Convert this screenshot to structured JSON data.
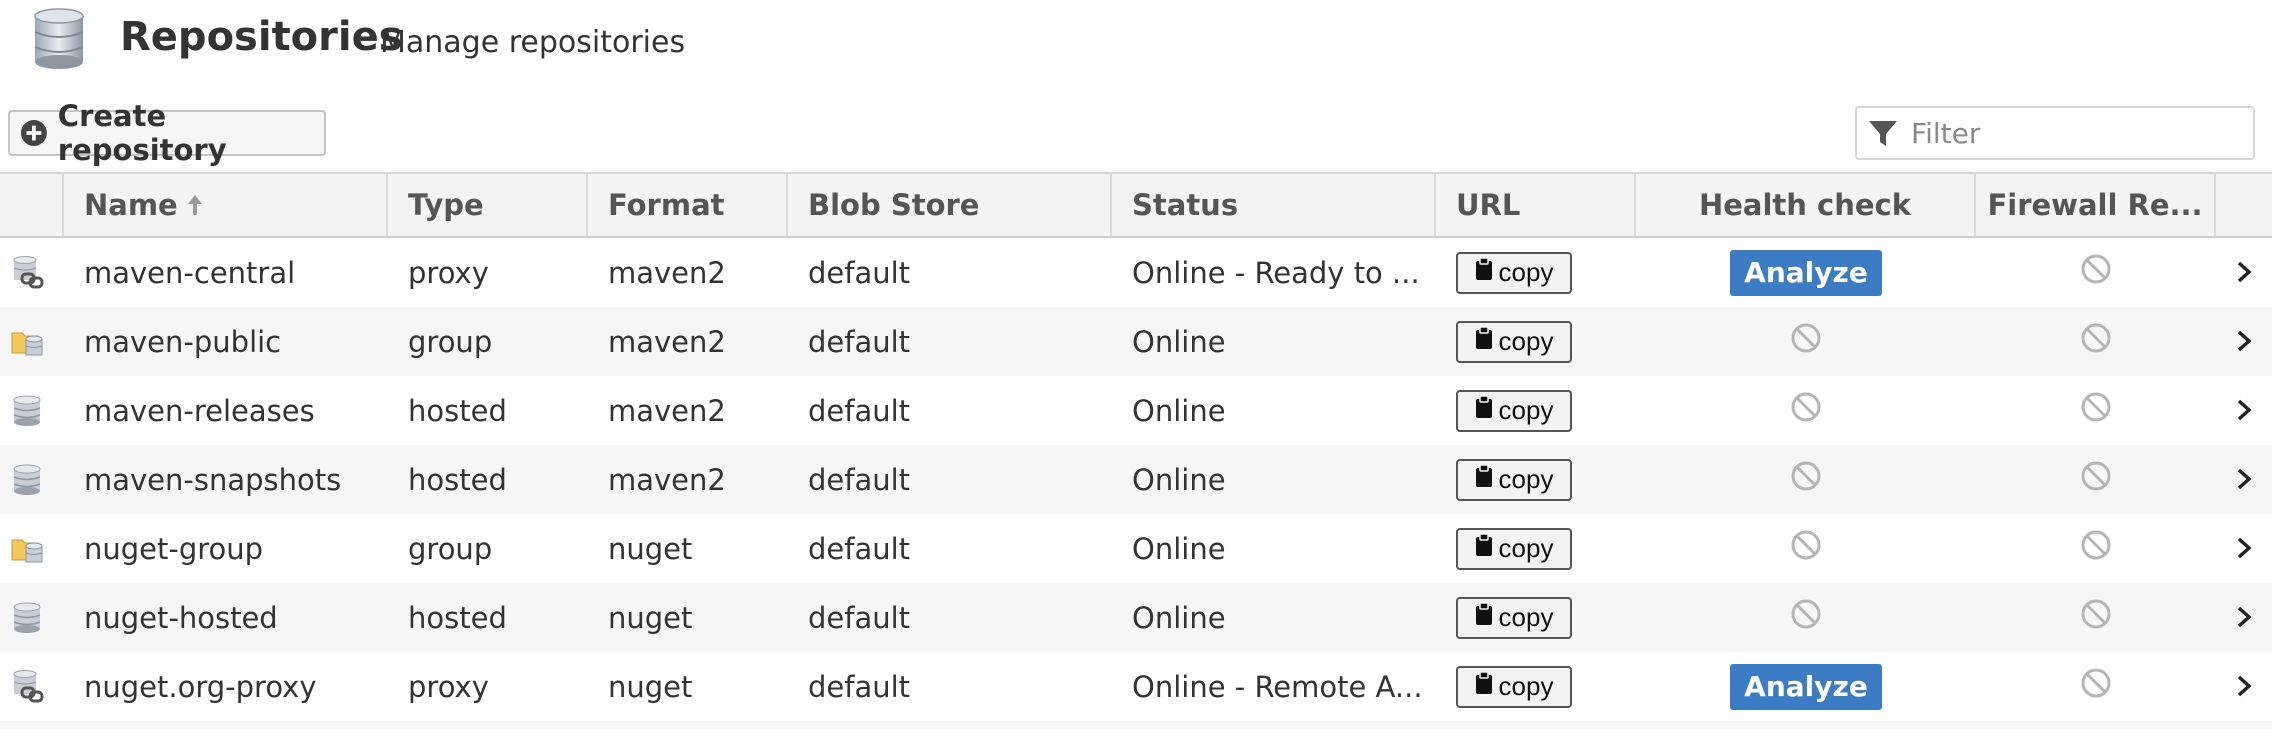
{
  "header": {
    "title": "Repositories",
    "subtitle": "Manage repositories"
  },
  "toolbar": {
    "create_label": "Create repository",
    "filter_placeholder": "Filter"
  },
  "columns": {
    "name": "Name",
    "type": "Type",
    "format": "Format",
    "blob_store": "Blob Store",
    "status": "Status",
    "url": "URL",
    "health_check": "Health check",
    "firewall": "Firewall Re..."
  },
  "sort": {
    "column": "Name",
    "direction": "ascending"
  },
  "rows": [
    {
      "icon": "proxy-repo-icon",
      "name": "maven-central",
      "type": "proxy",
      "format": "maven2",
      "blob_store": "default",
      "status": "Online - Ready to ...",
      "url_label": "copy",
      "health": "Analyze",
      "firewall": "disabled"
    },
    {
      "icon": "group-repo-icon",
      "name": "maven-public",
      "type": "group",
      "format": "maven2",
      "blob_store": "default",
      "status": "Online",
      "url_label": "copy",
      "health": "disabled",
      "firewall": "disabled"
    },
    {
      "icon": "hosted-repo-icon",
      "name": "maven-releases",
      "type": "hosted",
      "format": "maven2",
      "blob_store": "default",
      "status": "Online",
      "url_label": "copy",
      "health": "disabled",
      "firewall": "disabled"
    },
    {
      "icon": "hosted-repo-icon",
      "name": "maven-snapshots",
      "type": "hosted",
      "format": "maven2",
      "blob_store": "default",
      "status": "Online",
      "url_label": "copy",
      "health": "disabled",
      "firewall": "disabled"
    },
    {
      "icon": "group-repo-icon",
      "name": "nuget-group",
      "type": "group",
      "format": "nuget",
      "blob_store": "default",
      "status": "Online",
      "url_label": "copy",
      "health": "disabled",
      "firewall": "disabled"
    },
    {
      "icon": "hosted-repo-icon",
      "name": "nuget-hosted",
      "type": "hosted",
      "format": "nuget",
      "blob_store": "default",
      "status": "Online",
      "url_label": "copy",
      "health": "disabled",
      "firewall": "disabled"
    },
    {
      "icon": "proxy-repo-icon",
      "name": "nuget.org-proxy",
      "type": "proxy",
      "format": "nuget",
      "blob_store": "default",
      "status": "Online - Remote A...",
      "url_label": "copy",
      "health": "Analyze",
      "firewall": "disabled"
    }
  ],
  "colors": {
    "accent": "#3b7cc5",
    "header_bg": "#f4f4f4",
    "row_alt": "#f6f6f6",
    "muted_icon": "#b5b5b5"
  }
}
